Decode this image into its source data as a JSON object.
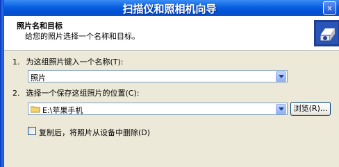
{
  "window": {
    "title": "扫描仪和照相机向导",
    "close_glyph": "x"
  },
  "header": {
    "title": "照片名和目标",
    "subtitle": "给您的照片选择一个名称和目标。",
    "icon": "wizard-icon"
  },
  "step1": {
    "number": "1.",
    "label": "为这组照片键入一个名称(T):",
    "value": "照片"
  },
  "step2": {
    "number": "2.",
    "label": "选择一个保存这组照片的位置(C):",
    "value": "E:\\苹果手机",
    "folder_icon": "folder-icon",
    "browse_label": "浏览(R)..."
  },
  "delete_option": {
    "label": "复制后，将照片从设备中删除(D)",
    "checked": false
  },
  "colors": {
    "titlebar": "#0a5fe0",
    "dialog": "#ece9d8",
    "accent": "#316ac5"
  }
}
